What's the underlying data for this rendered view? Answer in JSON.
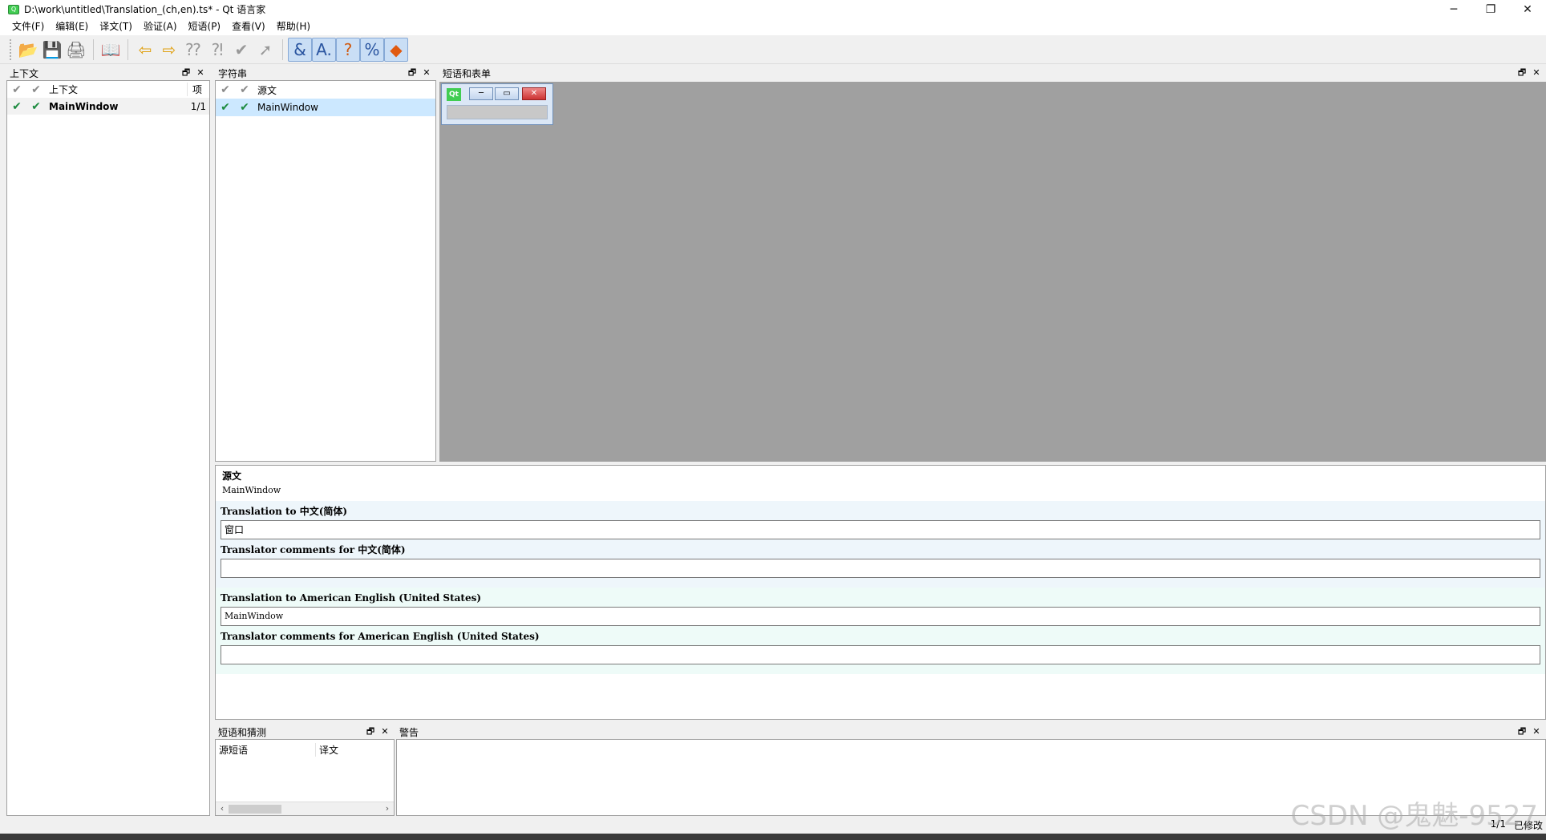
{
  "window": {
    "title": "D:\\work\\untitled\\Translation_(ch,en).ts* - Qt 语言家",
    "minimize": "─",
    "restore": "❐",
    "close": "✕"
  },
  "menu": [
    "文件(F)",
    "编辑(E)",
    "译文(T)",
    "验证(A)",
    "短语(P)",
    "查看(V)",
    "帮助(H)"
  ],
  "toolbar_icons": [
    "open-icon",
    "save-icon",
    "print-icon",
    "phrasebook-icon",
    "prev-icon",
    "next-icon",
    "prev-unfinished-icon",
    "next-unfinished-icon",
    "done-icon",
    "done-next-icon",
    "accelerators-icon",
    "ending-punctuation-icon",
    "phrase-matches-icon",
    "place-marker-icon",
    "form-preview-icon"
  ],
  "context_panel": {
    "title": "上下文",
    "header_label": "上下文",
    "header_count": "项",
    "rows": [
      {
        "name": "MainWindow",
        "count": "1/1"
      }
    ]
  },
  "strings_panel": {
    "title": "字符串",
    "header_label": "源文",
    "rows": [
      {
        "text": "MainWindow"
      }
    ]
  },
  "forms_panel": {
    "title": "短语和表单"
  },
  "editor": {
    "source_label": "源文",
    "source_text": "MainWindow",
    "sections": [
      {
        "translation_label": "Translation to 中文(简体)",
        "translation_value": "窗口",
        "comments_label": "Translator comments for 中文(简体)",
        "comments_value": ""
      },
      {
        "translation_label": "Translation to American English (United States)",
        "translation_value": "MainWindow",
        "comments_label": "Translator comments for American English (United States)",
        "comments_value": ""
      }
    ]
  },
  "phrases_panel": {
    "title": "短语和猜测",
    "col_source": "源短语",
    "col_translation": "译文"
  },
  "warnings_panel": {
    "title": "警告"
  },
  "status": {
    "count": "1/1",
    "modified": "已修改"
  },
  "watermark": "CSDN @鬼魅-9527",
  "colors": {
    "check_done": "#1d8b3f",
    "check_pending": "#8a8a8a",
    "selection": "#cce8ff"
  }
}
